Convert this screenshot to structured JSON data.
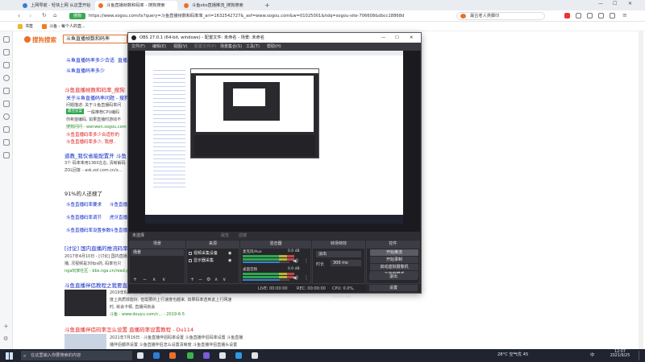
{
  "browser": {
    "tabs": [
      {
        "label": "上网导航 - 轻快上网 从这里开始",
        "color": "#3b7bd6",
        "active": false
      },
      {
        "label": "斗鱼直播帧数和码率 - 搜狗搜索",
        "color": "#e8712a",
        "active": true
      },
      {
        "label": "斗鱼obs直播推流_搜狗搜索",
        "color": "#e8712a",
        "active": false
      }
    ],
    "url_prefix": "搜狗",
    "url": "https://www.sogou.com/tx?query=斗鱼直播帧数和码率率_ari=1632542727&_asf=www.sogou.com&w=01025001&hdq=sogou-site-706608&dbcc18868d",
    "search_placeholder": "最古老人类脚印",
    "bookmarks": [
      "书签",
      "斗鱼 - 每个人的直..."
    ],
    "window_controls": [
      "—",
      "☐",
      "✕"
    ]
  },
  "results": {
    "logo": "搜狗搜索",
    "query": "斗鱼直播帧数和码率",
    "related_top": [
      "斗鱼直播码率多少合适",
      "直播码",
      "斗鱼直播码率多少"
    ],
    "r1_title": "斗鱼直播帧数和码率_搜狗",
    "r1_sub": "关于斗鱼直播码率问题 - 搜狗问",
    "r1_lines": [
      "问题描述: 关于斗鱼直播码率问",
      "一般推荐CPU编码",
      "你希望编码, 如果直播时游戏不",
      "搜狗问问 - wenwen.sogou.com"
    ],
    "r1_badge": "最佳答案",
    "r1_more": [
      "斗鱼直播码率多少合适秒的",
      "斗鱼直播码率多少, 我想.."
    ],
    "ad_title": "道教_我仅省能配置开 斗鱼",
    "ad_line1": "3个 码率率用1360左右, 清晰解码",
    "ad_line2": "ZOL回答 - ask.zol.com.cn/x...",
    "percent_line": "91%的人还搜了",
    "related_grid": [
      [
        "斗鱼直播码率要求",
        "斗鱼直播"
      ],
      [
        "斗鱼直播码率调节",
        "虎牙直播"
      ],
      [
        "斗鱼直播码率设置参数",
        "斗鱼直播"
      ]
    ],
    "r3_title": "[讨论] 国内直播的推流码率",
    "r3_lines": [
      "2017年4月10日 - [讨论] 国内直播的推流码",
      "播, 况视频是30fps的, 码率也只",
      "nga玩家社区 - bbs.nga.cn/read.p"
    ],
    "r4_title": "斗鱼直播伴侣教程之我要直播",
    "r4_lines": [
      "2019年6月5日 · 推荐配置上",
      "度上高质效能好, 但需要的上行速度也越来, 如果码率选到此上行网速",
      "时, 就会卡顿, 直播间就会"
    ],
    "r4_src": "斗鱼 - www.douyu.com/c... - 2019-6-5",
    "r5_title": "斗鱼直播伴侣码率怎么设置 直播码率设置教程 - Du114",
    "r5_lines": [
      "2021年7月16日 · 斗鱼直播伴侣码率设置 斗鱼直播伴侣码率设置 斗鱼直播",
      "播伴侣都供设置 斗鱼直播伴侣怎么设置清晰度 斗鱼直播伴侣直播头设置"
    ]
  },
  "obs": {
    "title": "OBS 27.0.1 (64-bit, windows) - 配置文件: 未命名 - 场景: 未命名",
    "menu": [
      "文件(F)",
      "编辑(E)",
      "视图(V)",
      "配置文件(P)",
      "场景集合(S)",
      "工具(T)",
      "帮助(H)"
    ],
    "no_source": "未选择",
    "props_btn": "属性",
    "filters_btn": "滤镜",
    "panels": {
      "scenes": "场景",
      "sources": "来源",
      "mixer": "混音器",
      "transitions": "转场特效",
      "controls": "控件"
    },
    "scene_items": [
      "场景"
    ],
    "source_items": [
      "视频采集设备",
      "显示器采集"
    ],
    "mixer_channels": [
      {
        "name": "麦克风/Aux",
        "db": "0.0 dB",
        "level": 0.8
      },
      {
        "name": "桌面音频",
        "db": "0.0 dB",
        "level": 0.8
      }
    ],
    "transition": {
      "type": "淡出",
      "duration_label": "时长",
      "duration": "300 ms"
    },
    "controls": [
      "开始推流",
      "开始录制",
      "启动虚拟摄像机",
      "工作室模式",
      "设置",
      "退出"
    ],
    "status": {
      "live": "LIVE: 00:00:00",
      "rec": "REC: 00:00:00",
      "cpu": "CPU: 0.0%, 30.00 fps"
    }
  },
  "taskbar": {
    "search": "在这里输入你要搜索的内容",
    "weather": "28°C 空气优 45",
    "lang": "中",
    "time": "12:07",
    "date": "2021/9/25",
    "icon_colors": [
      "#dfe3ea",
      "#2d7dd2",
      "#e8712a",
      "#3bb54a",
      "#7d5cd6",
      "#dfe3ea",
      "#2f9ae0",
      "#e2e2e2"
    ]
  }
}
